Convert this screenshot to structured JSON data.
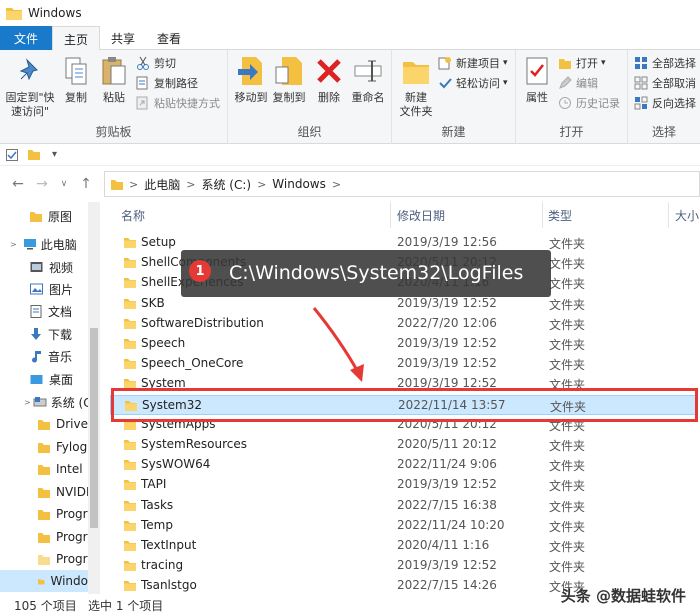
{
  "window": {
    "title": "Windows"
  },
  "tabs": [
    {
      "label": "文件"
    },
    {
      "label": "主页"
    },
    {
      "label": "共享"
    },
    {
      "label": "查看"
    }
  ],
  "ribbon": {
    "clipboard": {
      "label": "剪贴板",
      "pin": "固定到\"快速访问\"",
      "copy": "复制",
      "paste": "粘贴",
      "cut": "剪切",
      "copy_path": "复制路径",
      "paste_shortcut": "粘贴快捷方式"
    },
    "organize": {
      "label": "组织",
      "move_to": "移动到",
      "copy_to": "复制到",
      "delete": "删除",
      "rename": "重命名"
    },
    "new": {
      "label": "新建",
      "new_folder": "新建\n文件夹",
      "new_item": "新建项目",
      "easy_access": "轻松访问"
    },
    "open": {
      "label": "打开",
      "properties": "属性",
      "open": "打开",
      "edit": "编辑",
      "history": "历史记录"
    },
    "select": {
      "label": "选择",
      "select_all": "全部选择",
      "select_none": "全部取消",
      "invert": "反向选择"
    }
  },
  "address": {
    "crumbs": [
      "此电脑",
      "系统 (C:)",
      "Windows"
    ]
  },
  "nav": {
    "items": [
      {
        "label": "原图"
      },
      {
        "label": "此电脑"
      },
      {
        "label": "视频"
      },
      {
        "label": "图片"
      },
      {
        "label": "文档"
      },
      {
        "label": "下载"
      },
      {
        "label": "音乐"
      },
      {
        "label": "桌面"
      },
      {
        "label": "系统 (C"
      },
      {
        "label": "Driver"
      },
      {
        "label": "Fylog"
      },
      {
        "label": "Intel"
      },
      {
        "label": "NVIDI"
      },
      {
        "label": "Progr"
      },
      {
        "label": "Progr"
      },
      {
        "label": "Progr"
      },
      {
        "label": "Windo"
      }
    ]
  },
  "list": {
    "headers": {
      "name": "名称",
      "date": "修改日期",
      "type": "类型",
      "size": "大小"
    },
    "rows": [
      {
        "name": "Setup",
        "date": "2019/3/19 12:56",
        "type": "文件夹"
      },
      {
        "name": "ShellComponents",
        "date": "2020/5/11 20:12",
        "type": "文件夹"
      },
      {
        "name": "ShellExperiences",
        "date": "2020/4/11 1:16",
        "type": "文件夹"
      },
      {
        "name": "SKB",
        "date": "2019/3/19 12:52",
        "type": "文件夹"
      },
      {
        "name": "SoftwareDistribution",
        "date": "2022/7/20 12:06",
        "type": "文件夹"
      },
      {
        "name": "Speech",
        "date": "2019/3/19 12:52",
        "type": "文件夹"
      },
      {
        "name": "Speech_OneCore",
        "date": "2019/3/19 12:52",
        "type": "文件夹"
      },
      {
        "name": "System",
        "date": "2019/3/19 12:52",
        "type": "文件夹"
      },
      {
        "name": "System32",
        "date": "2022/11/14 13:57",
        "type": "文件夹"
      },
      {
        "name": "SystemApps",
        "date": "2020/5/11 20:12",
        "type": "文件夹"
      },
      {
        "name": "SystemResources",
        "date": "2020/5/11 20:12",
        "type": "文件夹"
      },
      {
        "name": "SysWOW64",
        "date": "2022/11/24 9:06",
        "type": "文件夹"
      },
      {
        "name": "TAPI",
        "date": "2019/3/19 12:52",
        "type": "文件夹"
      },
      {
        "name": "Tasks",
        "date": "2022/7/15 16:38",
        "type": "文件夹"
      },
      {
        "name": "Temp",
        "date": "2022/11/24 10:20",
        "type": "文件夹"
      },
      {
        "name": "TextInput",
        "date": "2020/4/11 1:16",
        "type": "文件夹"
      },
      {
        "name": "tracing",
        "date": "2019/3/19 12:52",
        "type": "文件夹"
      },
      {
        "name": "Tsanlstgo",
        "date": "2022/7/15 14:26",
        "type": "文件夹"
      }
    ]
  },
  "callout": {
    "badge": "1",
    "text": "C:\\Windows\\System32\\LogFiles"
  },
  "status": {
    "count": "105 个项目",
    "selected": "选中 1 个项目"
  },
  "watermark": "头条 @数据蛙软件",
  "colors": {
    "accent": "#1979ca",
    "folder": "#f4c042",
    "highlight": "#e53935",
    "selection": "#cce8ff"
  }
}
